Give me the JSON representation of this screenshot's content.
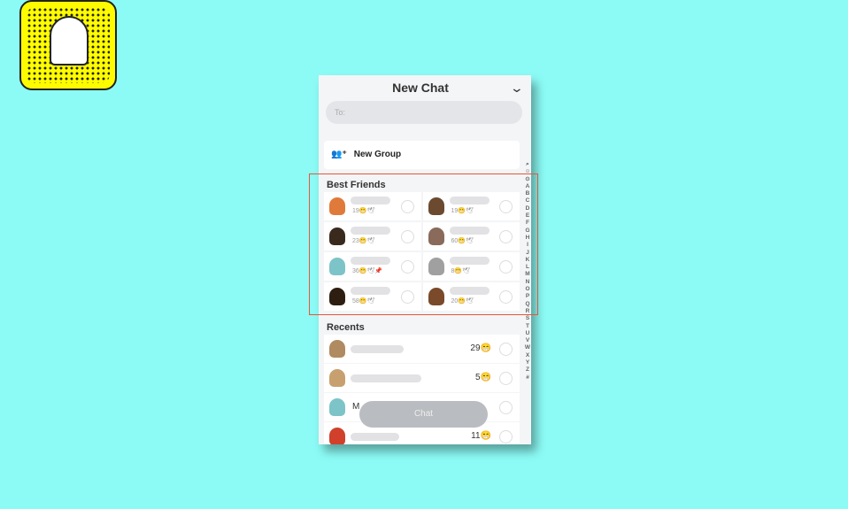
{
  "colors": {
    "background": "#8cfbf5",
    "highlight": "#e8553a",
    "logo": "#fffc00"
  },
  "header": {
    "title": "New Chat",
    "collapse_icon": "chevron-down-icon"
  },
  "to_field": {
    "placeholder": "To:"
  },
  "new_group": {
    "label": "New Group",
    "icon": "add-group-icon"
  },
  "best_friends": {
    "title": "Best Friends",
    "items": [
      {
        "score": "19😁🕊"
      },
      {
        "score": "19😁🕊"
      },
      {
        "score": "23😁🕊"
      },
      {
        "score": "60😁🕊"
      },
      {
        "score": "36😁🕊📌"
      },
      {
        "score": "8😁🕊"
      },
      {
        "score": "58😁🕊"
      },
      {
        "score": "20😁🕊"
      }
    ]
  },
  "recents": {
    "title": "Recents",
    "items": [
      {
        "score": "29😁"
      },
      {
        "score": "5😁"
      },
      {
        "score": "M"
      },
      {
        "score": "11😁"
      }
    ]
  },
  "alphabet": [
    "⌕",
    "☺",
    "⊙",
    "A",
    "B",
    "C",
    "D",
    "E",
    "F",
    "G",
    "H",
    "I",
    "J",
    "K",
    "L",
    "M",
    "N",
    "O",
    "P",
    "Q",
    "R",
    "S",
    "T",
    "U",
    "V",
    "W",
    "X",
    "Y",
    "Z",
    "#"
  ],
  "chat_button": "Chat"
}
